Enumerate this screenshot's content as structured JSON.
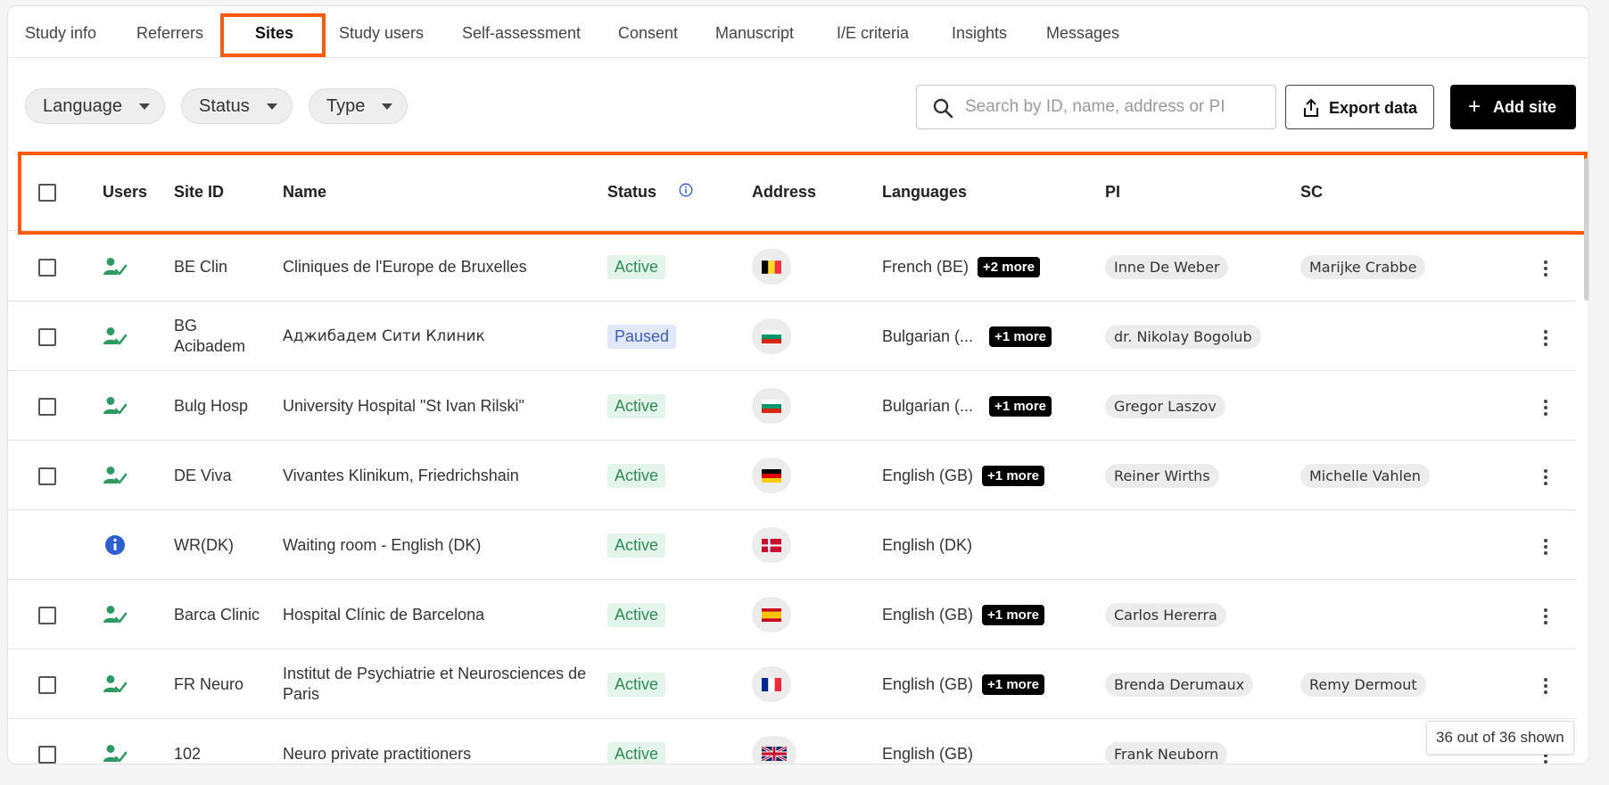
{
  "tabs": [
    {
      "label": "Study info",
      "active": false
    },
    {
      "label": "Referrers",
      "active": false
    },
    {
      "label": "Sites",
      "active": true
    },
    {
      "label": "Study users",
      "active": false
    },
    {
      "label": "Self-assessment",
      "active": false
    },
    {
      "label": "Consent",
      "active": false
    },
    {
      "label": "Manuscript",
      "active": false
    },
    {
      "label": "I/E criteria",
      "active": false
    },
    {
      "label": "Insights",
      "active": false
    },
    {
      "label": "Messages",
      "active": false
    }
  ],
  "filters": {
    "language": "Language",
    "status": "Status",
    "type": "Type"
  },
  "search": {
    "placeholder": "Search by ID, name, address or PI",
    "value": ""
  },
  "toolbar": {
    "export_label": "Export data",
    "add_label": "Add site"
  },
  "columns": {
    "users": "Users",
    "site_id": "Site ID",
    "name": "Name",
    "status": "Status",
    "address": "Address",
    "languages": "Languages",
    "pi": "PI",
    "sc": "SC"
  },
  "rows": [
    {
      "user_icon": "user-check-icon",
      "site_id": "BE Clin",
      "name": "Cliniques de l'Europe de Bruxelles",
      "status": "Active",
      "flag": "flag-be-icon",
      "language": "French (BE)",
      "more": "+2 more",
      "pi": "Inne De Weber",
      "sc": "Marijke Crabbe"
    },
    {
      "user_icon": "user-check-icon",
      "site_id": "BG Acibadem",
      "name": "Аджибадем Сити Клиник",
      "status": "Paused",
      "flag": "flag-bg-icon",
      "language": "Bulgarian (...",
      "more": "+1 more",
      "pi": "dr. Nikolay Bogolub",
      "sc": ""
    },
    {
      "user_icon": "user-check-icon",
      "site_id": "Bulg Hosp",
      "name": "University Hospital \"St Ivan Rilski\"",
      "status": "Active",
      "flag": "flag-bg-icon",
      "language": "Bulgarian (...",
      "more": "+1 more",
      "pi": "Gregor Laszov",
      "sc": ""
    },
    {
      "user_icon": "user-check-icon",
      "site_id": "DE Viva",
      "name": "Vivantes Klinikum, Friedrichshain",
      "status": "Active",
      "flag": "flag-de-icon",
      "language": "English (GB)",
      "more": "+1 more",
      "pi": "Reiner Wirths",
      "sc": "Michelle Vahlen"
    },
    {
      "user_icon": "info-icon",
      "site_id": "WR(DK)",
      "name": "Waiting room - English (DK)",
      "status": "Active",
      "flag": "flag-dk-icon",
      "language": "English (DK)",
      "more": "",
      "pi": "",
      "sc": ""
    },
    {
      "user_icon": "user-check-icon",
      "site_id": "Barca Clinic",
      "name": "Hospital Clínic de Barcelona",
      "status": "Active",
      "flag": "flag-es-icon",
      "language": "English (GB)",
      "more": "+1 more",
      "pi": "Carlos Hererra",
      "sc": ""
    },
    {
      "user_icon": "user-check-icon",
      "site_id": "FR Neuro",
      "name": "Institut de Psychiatrie et Neurosciences de Paris",
      "status": "Active",
      "flag": "flag-fr-icon",
      "language": "English (GB)",
      "more": "+1 more",
      "pi": "Brenda Derumaux",
      "sc": "Remy Dermout"
    },
    {
      "user_icon": "user-check-icon",
      "site_id": "102",
      "name": "Neuro private practitioners",
      "status": "Active",
      "flag": "flag-gb-icon",
      "language": "English (GB)",
      "more": "",
      "pi": "Frank Neuborn",
      "sc": ""
    }
  ],
  "footer": {
    "count": "36 out of 36 shown"
  },
  "colors": {
    "accent_highlight": "#ff5a0a",
    "active_green": "#2e8b57",
    "paused_blue": "#3f5db5",
    "info_blue": "#2f5fcf"
  }
}
